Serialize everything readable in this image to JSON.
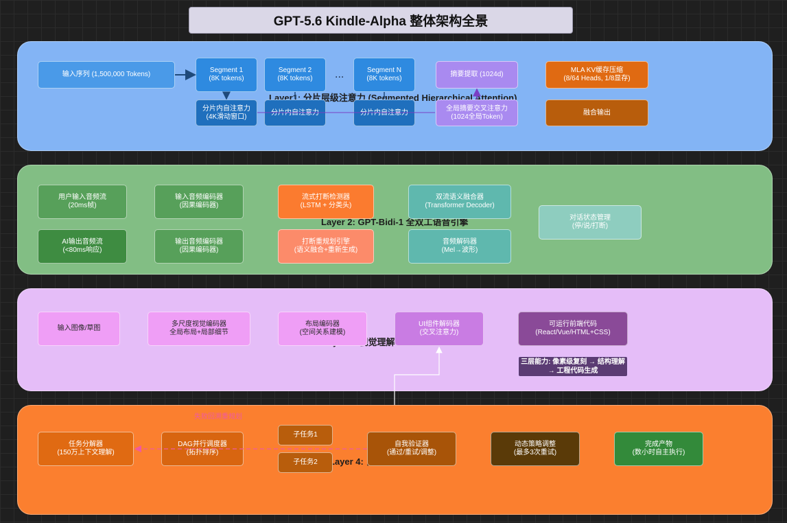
{
  "title": "GPT-5.6 Kindle-Alpha 整体架构全景",
  "colors": {
    "background": "#1f1f1f",
    "layer1": "#83b4f5",
    "layer2": "#82be84",
    "layer3": "#e5bdf8",
    "layer4": "#fb7f2f"
  },
  "layer1": {
    "label": "Layer1: 分片层级注意力 (Segmented Hierarchical Attention)",
    "input": [
      "输入序列 (1,500,000 Tokens)"
    ],
    "seg1": [
      "Segment 1",
      "(8K tokens)"
    ],
    "seg2": [
      "Segment 2",
      "(8K tokens)"
    ],
    "dots": "...",
    "segN": [
      "Segment N",
      "(8K tokens)"
    ],
    "intra1": [
      "分片内自注意力",
      "(4K滑动窗口)"
    ],
    "intra2": [
      "分片内自注意力"
    ],
    "intraN": [
      "分片内自注意力"
    ],
    "summary": [
      "摘要提取 (1024d)"
    ],
    "cross": [
      "全局摘要交叉注意力",
      "(1024全局Token)"
    ],
    "mla": [
      "MLA KV缓存压缩",
      "(8/64 Heads, 1/8显存)"
    ],
    "fuse": [
      "融合输出"
    ]
  },
  "layer2": {
    "label": "Layer 2: GPT-Bidi-1 全双工语音引擎",
    "user_audio": [
      "用户输入音频流",
      "(20ms帧)"
    ],
    "in_encoder": [
      "输入音频编码器",
      "(因果编码器)"
    ],
    "interrupt_detect": [
      "流式打断检测器",
      "(LSTM + 分类头)"
    ],
    "fusion": [
      "双流语义融合器",
      "(Transformer Decoder)"
    ],
    "dialog_state": [
      "对话状态管理",
      "(停/说/打断)"
    ],
    "ai_audio": [
      "AI输出音频流",
      "(<80ms响应)"
    ],
    "out_encoder": [
      "输出音频编码器",
      "(因果编码器)"
    ],
    "replan": [
      "打断重规划引擎",
      "(语义融合+重新生成)"
    ],
    "audio_decoder": [
      "音频解码器",
      "(Mel→波形)"
    ]
  },
  "layer3": {
    "label": "Layer 3: 视觉理解",
    "input_image": [
      "输入图像/草图"
    ],
    "vis_encoder": [
      "多尺度视觉编码器",
      "全局布局+局部细节"
    ],
    "layout_encoder": [
      "布局编码器",
      "(空间关系建模)"
    ],
    "ui_decoder": [
      "UI组件解码器",
      "(交叉注意力)"
    ],
    "code": [
      "可运行前端代码",
      "(React/Vue/HTML+CSS)"
    ],
    "capabilities": [
      "三层能力: 像素级复刻 → 结构理解",
      "→ 工程代码生成"
    ]
  },
  "layer4": {
    "label": "Layer 4: 自主执行引擎",
    "note": "失败回溯重规划",
    "decomposer": [
      "任务分解器",
      "(150万上下文理解)"
    ],
    "dag": [
      "DAG并行调度器",
      "(拓扑排序)"
    ],
    "sub1": [
      "子任务1"
    ],
    "sub2": [
      "子任务2"
    ],
    "verifier": [
      "自我验证器",
      "(通过/重试/调整)"
    ],
    "strategy": [
      "动态策略调整",
      "(最多3次重试)"
    ],
    "done": [
      "完成产物",
      "(数小时自主执行)"
    ]
  }
}
